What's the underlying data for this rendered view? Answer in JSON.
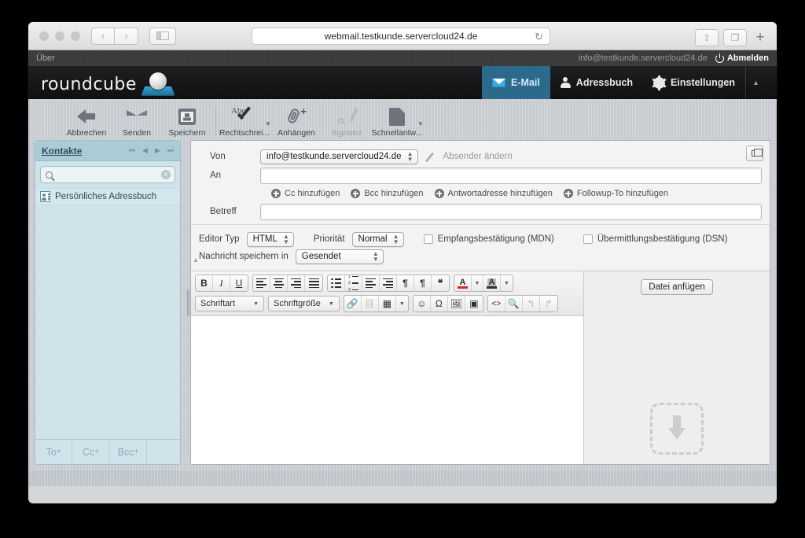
{
  "browser": {
    "url": "webmail.testkunde.servercloud24.de",
    "back_label": "‹",
    "forward_label": "›",
    "reload_label": "↻",
    "share_label": "⇪",
    "tabs_label": "❐",
    "newtab_label": "+"
  },
  "topline": {
    "about": "Über",
    "user": "info@testkunde.servercloud24.de",
    "logout": "Abmelden"
  },
  "header": {
    "logo": "roundcube",
    "tabs": [
      {
        "label": "E-Mail",
        "icon": "mail-icon",
        "active": true
      },
      {
        "label": "Adressbuch",
        "icon": "person-icon",
        "active": false
      },
      {
        "label": "Einstellungen",
        "icon": "gear-icon",
        "active": false
      }
    ],
    "collapse": "▲"
  },
  "toolbar": [
    {
      "label": "Abbrechen",
      "icon": "back-arrow-icon",
      "disabled": false,
      "caret": false
    },
    {
      "label": "Senden",
      "icon": "send-icon",
      "disabled": false,
      "caret": false
    },
    {
      "label": "Speichern",
      "icon": "save-icon",
      "disabled": false,
      "caret": false
    },
    {
      "label": "Rechtschrei...",
      "icon": "spellcheck-icon",
      "disabled": false,
      "caret": true
    },
    {
      "label": "Anhängen",
      "icon": "paperclip-plus-icon",
      "disabled": false,
      "caret": false
    },
    {
      "label": "Signatur",
      "icon": "signature-icon",
      "disabled": true,
      "caret": false
    },
    {
      "label": "Schnellantw...",
      "icon": "document-icon",
      "disabled": false,
      "caret": true
    }
  ],
  "contacts": {
    "title": "Kontakte",
    "pager": [
      "⏮",
      "◀",
      "▶",
      "⏭"
    ],
    "search_placeholder": "",
    "search_value": "",
    "items": [
      {
        "label": "Persönliches Adressbuch"
      }
    ],
    "footer": [
      {
        "label": "To",
        "sup": "+"
      },
      {
        "label": "Cc",
        "sup": "+"
      },
      {
        "label": "Bcc",
        "sup": "+"
      }
    ]
  },
  "compose": {
    "from_label": "Von",
    "from_value": "info@testkunde.servercloud24.de",
    "change_sender": "Absender ändern",
    "to_label": "An",
    "to_value": "",
    "add_links": [
      "Cc hinzufügen",
      "Bcc hinzufügen",
      "Antwortadresse hinzufügen",
      "Followup-To hinzufügen"
    ],
    "subject_label": "Betreff",
    "subject_value": "",
    "options": {
      "editor_type_label": "Editor Typ",
      "editor_type_value": "HTML",
      "priority_label": "Priorität",
      "priority_value": "Normal",
      "mdn_label": "Empfangsbestätigung (MDN)",
      "dsn_label": "Übermittlungsbestätigung (DSN)",
      "save_in_label": "Nachricht speichern in",
      "save_in_value": "Gesendet"
    },
    "editor": {
      "bold": "B",
      "italic": "I",
      "underline": "U",
      "align_left": "align-left-icon",
      "align_center": "align-center-icon",
      "align_right": "align-right-icon",
      "align_justify": "align-justify-icon",
      "bullet_list": "unordered-list-icon",
      "number_list": "ordered-list-icon",
      "outdent": "outdent-icon",
      "indent": "indent-icon",
      "ltr": "¶",
      "rtl": "¶",
      "blockquote": "❝",
      "text_color": "A",
      "highlight_color": "A",
      "fontname_label": "Schriftart",
      "fontsize_label": "Schriftgröße",
      "link": "🔗",
      "unlink": "unlink-icon",
      "table": "table-icon",
      "emoji": "☺",
      "charmap": "Ω",
      "image": "image-icon",
      "media": "media-icon",
      "source": "<>",
      "search": "search-icon",
      "undo": "↰",
      "redo": "↱",
      "body_value": ""
    },
    "attach_button": "Datei anfügen",
    "dropzone_icon": "download-arrow-icon"
  }
}
